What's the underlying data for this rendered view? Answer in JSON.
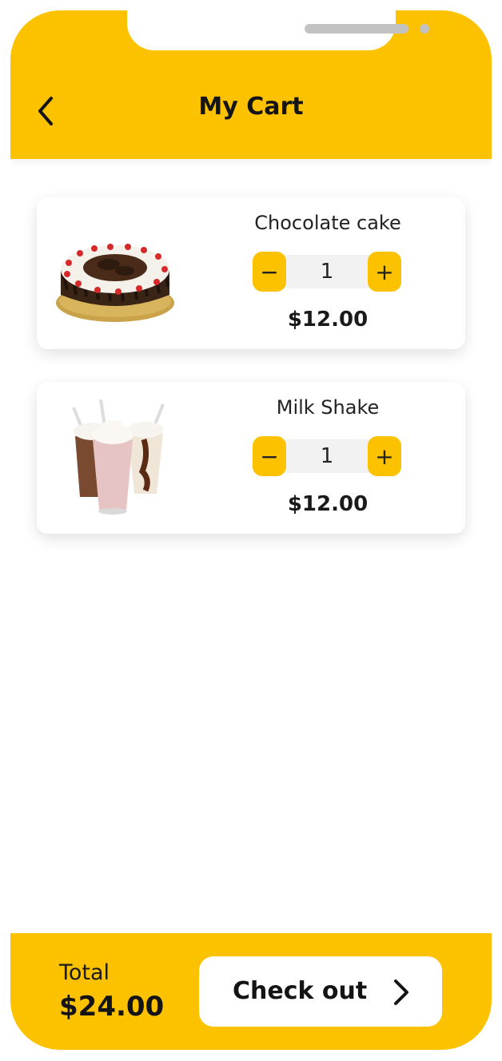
{
  "header": {
    "title": "My Cart",
    "back_icon": "chevron-left-icon"
  },
  "cart": {
    "items": [
      {
        "name": "Chocolate cake",
        "quantity": "1",
        "price": "$12.00",
        "image": "chocolate-cake-image"
      },
      {
        "name": "Milk Shake",
        "quantity": "1",
        "price": "$12.00",
        "image": "milk-shake-image"
      }
    ],
    "decrement_symbol": "−",
    "increment_symbol": "+"
  },
  "footer": {
    "total_label": "Total",
    "total_value": "$24.00",
    "checkout_label": "Check out",
    "checkout_icon": "chevron-right-icon"
  },
  "colors": {
    "accent": "#FCC200",
    "background": "#FFFFFF",
    "text": "#141414"
  }
}
